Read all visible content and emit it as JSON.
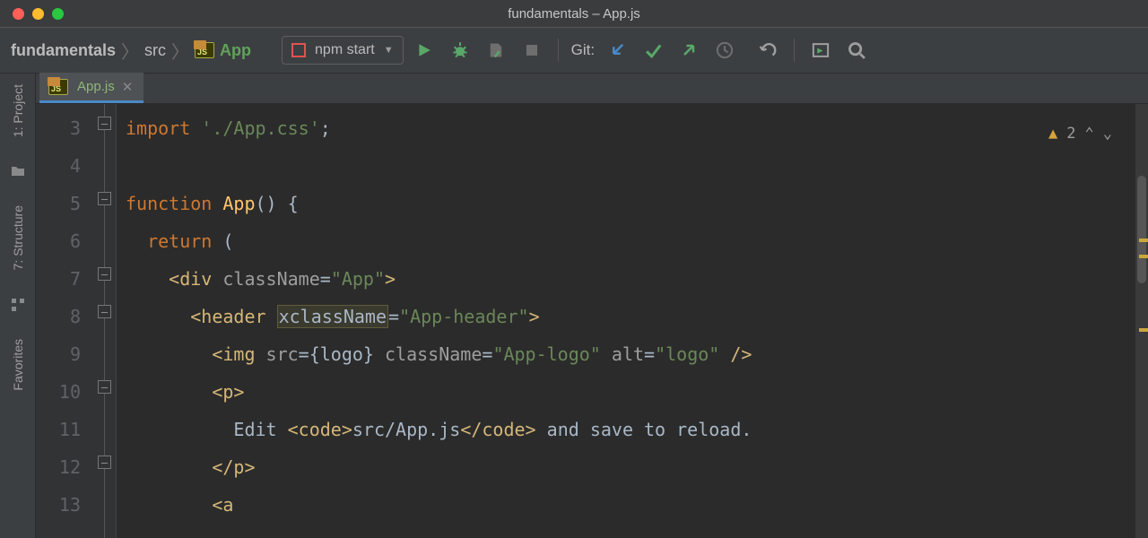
{
  "window": {
    "title": "fundamentals – App.js"
  },
  "breadcrumb": {
    "project": "fundamentals",
    "folder": "src",
    "file": "App"
  },
  "run": {
    "label": "npm start"
  },
  "git": {
    "label": "Git:"
  },
  "tab": {
    "label": "App.js"
  },
  "sidebar": {
    "project": "1: Project",
    "structure": "7: Structure",
    "favorites": "Favorites"
  },
  "inspector": {
    "warn_count": "2"
  },
  "lines": [
    "3",
    "4",
    "5",
    "6",
    "7",
    "8",
    "9",
    "10",
    "11",
    "12",
    "13"
  ],
  "code": {
    "l3_import": "import",
    "l3_path": "'./App.css'",
    "l3_semi": ";",
    "l5_fn": "function",
    "l5_name": "App",
    "l5_paren": "() {",
    "l6_return": "return",
    "l6_paren": " (",
    "l7": "<div className=\"App\">",
    "l7_open": "<",
    "l7_tag": "div",
    "l7_sp": " ",
    "l7_attr": "className",
    "l7_eq": "=",
    "l7_str": "\"App\"",
    "l7_close": ">",
    "l8_open": "<",
    "l8_tag": "header",
    "l8_sp": " ",
    "l8_attr": "xclassName",
    "l8_eq": "=",
    "l8_str": "\"App-header\"",
    "l8_close": ">",
    "l9_open": "<",
    "l9_tag": "img",
    "l9_sp": " ",
    "l9_a1": "src",
    "l9_e1": "=",
    "l9_v1": "{logo}",
    "l9_a2": " className",
    "l9_e2": "=",
    "l9_v2": "\"App-logo\"",
    "l9_a3": " alt",
    "l9_e3": "=",
    "l9_v3": "\"logo\"",
    "l9_close": " />",
    "l10": "<p>",
    "l11_pre": "Edit ",
    "l11_co": "<code>",
    "l11_mid": "src/App.js",
    "l11_cc": "</code>",
    "l11_post": " and save to reload.",
    "l12": "</p>",
    "l13": "<a"
  }
}
